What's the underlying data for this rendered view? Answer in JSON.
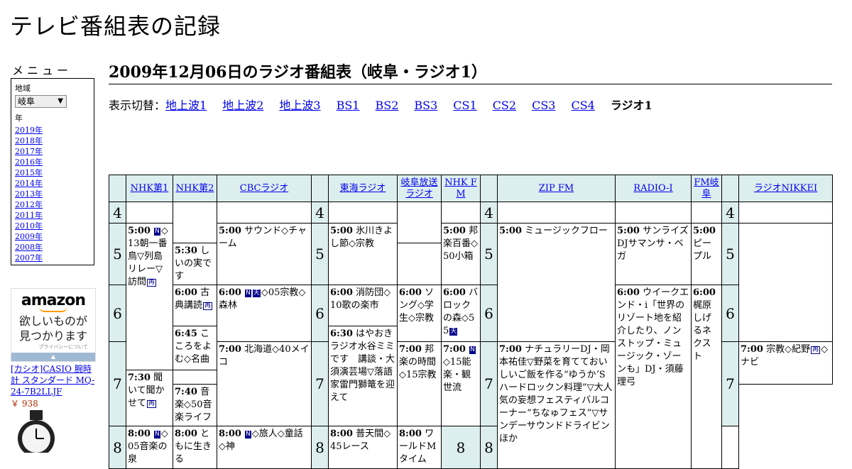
{
  "site_title": "テレビ番組表の記録",
  "menu": {
    "heading": "メニュー",
    "region_label": "地域",
    "region_value": "岐阜",
    "year_label": "年",
    "years": [
      "2019年",
      "2018年",
      "2017年",
      "2016年",
      "2015年",
      "2014年",
      "2013年",
      "2012年",
      "2011年",
      "2010年",
      "2009年",
      "2008年",
      "2007年"
    ]
  },
  "ad": {
    "logo": "amazon",
    "line1": "欲しいものが",
    "line2": "見つかります",
    "privacy": "プライバシーについて",
    "product_title": "[カシオ]CASIO 腕時計 スタンダード MQ-24-7B2LLJF",
    "product_price": "￥ 938"
  },
  "page_title": "2009年12月06日のラジオ番組表（岐阜・ラジオ1）",
  "switcher": {
    "label": "表示切替：",
    "links": [
      "地上波1",
      "地上波2",
      "地上波3",
      "BS1",
      "BS2",
      "BS3",
      "CS1",
      "CS2",
      "CS3",
      "CS4"
    ],
    "current": "ラジオ1"
  },
  "stations": [
    "NHK第1",
    "NHK第2",
    "CBCラジオ",
    "東海ラジオ",
    "岐阜放送ラジオ",
    "NHK FM",
    "ZIP FM",
    "RADIO-I",
    "FM岐阜",
    "ラジオNIKKEI"
  ],
  "hours": [
    "4",
    "5",
    "6",
    "7",
    "8"
  ],
  "icons": {
    "news_mark": "N",
    "rebroadcast_mark": "再",
    "weather_mark": "天"
  },
  "programs": {
    "nhk1_5": {
      "time": "5:00",
      "text": "◇13朝一番　鳥▽列島リレー▽訪問"
    },
    "nhk1_8": {
      "time": "8:00",
      "text": "◇05音楽の泉"
    },
    "nhk2_6": {
      "time": "6:00",
      "text": "古典講読"
    },
    "nhk2_645": {
      "time": "6:45",
      "text": "こころをよむ◇名曲"
    },
    "nhk2_730": {
      "time": "7:30",
      "text": "聞いて聞かせて"
    },
    "nhk2_8": {
      "time": "8:00",
      "text": "ともに生きる"
    },
    "cbc_5": {
      "time": "5:00",
      "text": "サウンド◇チャーム"
    },
    "cbc_6": {
      "time": "6:00",
      "text": "◇05宗教◇森林"
    },
    "cbc_7": {
      "time": "7:00",
      "text": "北海道◇40メイコ"
    },
    "cbc_8": {
      "time": "8:00",
      "text": "◇旅人◇童話◇神"
    },
    "tokai_5": {
      "time": "5:00",
      "text": "氷川きよし節◇宗教"
    },
    "tokai_6": {
      "time": "6:00",
      "text": "消防団◇10歌の楽市"
    },
    "tokai_630": {
      "time": "6:30",
      "text": "はやおきラジオ水谷ミミです　講談・大須演芸場▽落語家雷門獅篭を迎えて"
    },
    "gifu_530": {
      "time": "5:30",
      "text": "しいの実です"
    },
    "gifu_6": {
      "time": "6:00",
      "text": "ソング◇学生◇宗教"
    },
    "gifu_7": {
      "time": "7:00",
      "text": "邦楽の時間◇15宗教"
    },
    "gifu_8": {
      "time": "8:00",
      "text": "普天間◇45レース"
    },
    "nhkfm_5": {
      "time": "5:00",
      "text": "邦楽百番◇50小箱"
    },
    "nhkfm_6": {
      "time": "6:00",
      "text": "バロックの森◇55"
    },
    "nhkfm_7": {
      "time": "7:00",
      "text": "◇15能楽・観世流"
    },
    "nhkfm_8": {
      "time": "8:00",
      "text": "ワールドMタイム"
    },
    "zip_5": {
      "time": "5:00",
      "text": "ミュージックフロー"
    },
    "zip_7": {
      "time": "7:00",
      "text": "ナチュラリーDJ・岡本祐佳▽野菜を育てておいしいご飯を作る“ゆうかʼSハードロックン料理”▽大人気の妄想フェスティバルコーナー“ちなゅフェス”▽サンデーサウンドドライビンほか"
    },
    "radioi_5": {
      "time": "5:00",
      "text": "サンライズDJサマンサ・ベガ"
    },
    "radioi_6": {
      "time": "6:00",
      "text": "ウイークエンド・i「世界のリゾート地を紹介したり、ノンストップ・ミュージック・ゾーンも」DJ・須藤理弓"
    },
    "fmgifu_5": {
      "time": "5:00",
      "text": "ピープル"
    },
    "fmgifu_6": {
      "time": "6:00",
      "text": "梶原しげるネクスト"
    },
    "nikkei_7": {
      "time": "7:00",
      "text": "宗教◇紀野"
    },
    "nikkei_7b": {
      "text": "◇ナビ"
    },
    "nikkei_740": {
      "time": "7:40",
      "text": "音楽◇50音楽ライフ"
    }
  }
}
